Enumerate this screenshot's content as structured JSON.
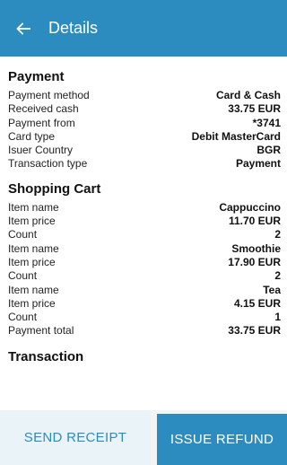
{
  "appbar": {
    "title": "Details",
    "back_icon": "arrow-left-icon"
  },
  "colors": {
    "primary": "#2c8cc0",
    "secondary_bg": "#eaf3f8"
  },
  "payment": {
    "title": "Payment",
    "rows": [
      {
        "label": "Payment method",
        "value": "Card & Cash"
      },
      {
        "label": "Received cash",
        "value": "33.75 EUR"
      },
      {
        "label": "Payment from",
        "value": "*3741"
      },
      {
        "label": "Card type",
        "value": "Debit MasterCard"
      },
      {
        "label": "Isuer Country",
        "value": "BGR"
      },
      {
        "label": "Transaction type",
        "value": "Payment"
      }
    ]
  },
  "cart": {
    "title": "Shopping Cart",
    "rows": [
      {
        "label": "Item name",
        "value": "Cappuccino"
      },
      {
        "label": "Item price",
        "value": "11.70 EUR"
      },
      {
        "label": "Count",
        "value": "2"
      },
      {
        "label": "Item name",
        "value": "Smoothie"
      },
      {
        "label": "Item price",
        "value": "17.90 EUR"
      },
      {
        "label": "Count",
        "value": "2"
      },
      {
        "label": "Item name",
        "value": "Tea"
      },
      {
        "label": "Item price",
        "value": "4.15 EUR"
      },
      {
        "label": "Count",
        "value": "1"
      },
      {
        "label": "Payment total",
        "value": "33.75 EUR"
      }
    ]
  },
  "transaction": {
    "title": "Transaction"
  },
  "footer": {
    "send_receipt": "SEND RECEIPT",
    "issue_refund": "ISSUE REFUND"
  }
}
